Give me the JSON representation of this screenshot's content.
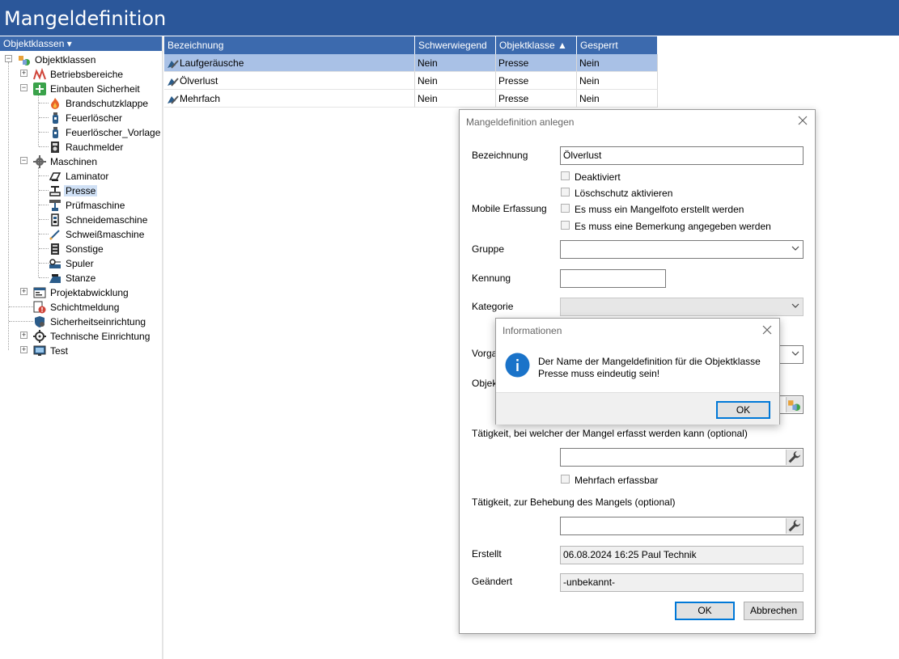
{
  "app": {
    "title": "Mangeldefinition"
  },
  "left_panel": {
    "header": "Objektklassen ▾",
    "tree": [
      {
        "label": "Objektklassen",
        "icon": "objektklassen-icon",
        "expander": "-"
      },
      {
        "label": "Betriebsbereiche",
        "icon": "betriebsbereiche-icon",
        "expander": "+"
      },
      {
        "label": "Einbauten Sicherheit",
        "icon": "green-plus-icon",
        "expander": "-"
      },
      {
        "label": "Brandschutzklappe",
        "icon": "flame-icon"
      },
      {
        "label": "Feuerlöscher",
        "icon": "fire-extinguisher-icon"
      },
      {
        "label": "Feuerlöscher_Vorlage",
        "icon": "fire-extinguisher-icon"
      },
      {
        "label": "Rauchmelder",
        "icon": "smoke-detector-icon"
      },
      {
        "label": "Maschinen",
        "icon": "gear-icon",
        "expander": "-"
      },
      {
        "label": "Laminator",
        "icon": "laminator-icon"
      },
      {
        "label": "Presse",
        "icon": "press-icon",
        "selected": true
      },
      {
        "label": "Prüfmaschine",
        "icon": "test-machine-icon"
      },
      {
        "label": "Schneidemaschine",
        "icon": "cutting-machine-icon"
      },
      {
        "label": "Schweißmaschine",
        "icon": "welding-icon"
      },
      {
        "label": "Sonstige",
        "icon": "cabinet-icon"
      },
      {
        "label": "Spuler",
        "icon": "spooler-icon"
      },
      {
        "label": "Stanze",
        "icon": "punch-icon"
      },
      {
        "label": "Projektabwicklung",
        "icon": "project-icon",
        "expander": "+"
      },
      {
        "label": "Schichtmeldung",
        "icon": "shift-report-icon"
      },
      {
        "label": "Sicherheitseinrichtung",
        "icon": "shield-person-icon"
      },
      {
        "label": "Technische Einrichtung",
        "icon": "cog-icon",
        "expander": "+"
      },
      {
        "label": "Test",
        "icon": "monitor-icon",
        "expander": "+"
      }
    ]
  },
  "grid": {
    "columns": [
      "Bezeichnung",
      "Schwerwiegend",
      "Objektklasse ▲",
      "Gesperrt"
    ],
    "rows": [
      {
        "bezeichnung": "Laufgeräusche",
        "schwerwiegend": "Nein",
        "objektklasse": "Presse",
        "gesperrt": "Nein",
        "selected": true
      },
      {
        "bezeichnung": "Ölverlust",
        "schwerwiegend": "Nein",
        "objektklasse": "Presse",
        "gesperrt": "Nein"
      },
      {
        "bezeichnung": "Mehrfach",
        "schwerwiegend": "Nein",
        "objektklasse": "Presse",
        "gesperrt": "Nein"
      }
    ]
  },
  "dialog": {
    "title": "Mangeldefinition anlegen",
    "bezeichnung_label": "Bezeichnung",
    "bezeichnung_value": "Ölverlust",
    "checks": {
      "deaktiviert": "Deaktiviert",
      "loeschschutz": "Löschschutz aktivieren",
      "mangelfoto": "Es muss ein Mangelfoto erstellt werden",
      "bemerkung": "Es muss eine Bemerkung angegeben werden",
      "mehrfach": "Mehrfach erfassbar"
    },
    "mobile_label": "Mobile Erfassung",
    "gruppe_label": "Gruppe",
    "kennung_label": "Kennung",
    "kategorie_label": "Kategorie",
    "vorgang_label_partial": "Vorga",
    "objekt_label_partial": "Objek",
    "taetigkeit_erfassung_label": "Tätigkeit, bei welcher der Mangel erfasst werden kann (optional)",
    "taetigkeit_behebung_label": "Tätigkeit, zur Behebung des Mangels (optional)",
    "erstellt_label": "Erstellt",
    "erstellt_value": "06.08.2024 16:25 Paul Technik",
    "geaendert_label": "Geändert",
    "geaendert_value": "-unbekannt-",
    "ok": "OK",
    "cancel": "Abbrechen"
  },
  "info_dialog": {
    "title": "Informationen",
    "message_line1": "Der Name der Mangeldefinition für die Objektklasse",
    "message_line2": "Presse muss eindeutig sein!",
    "ok": "OK"
  },
  "colors": {
    "titlebar": "#2b579a",
    "header": "#3c6aae",
    "selection": "#a9c1e6",
    "info_icon": "#1a73c9"
  }
}
